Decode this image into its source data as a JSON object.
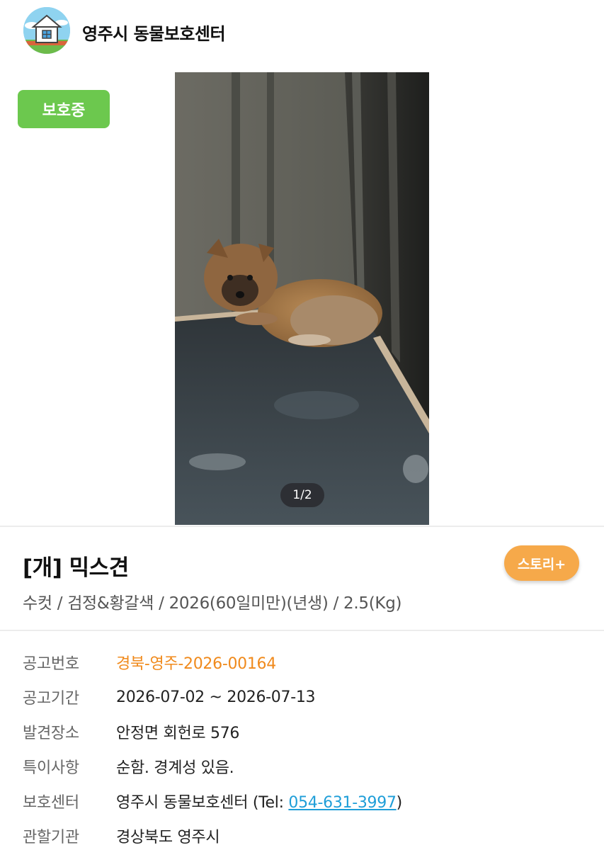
{
  "header": {
    "logo_icon": "shelter-house-icon",
    "shelter_name": "영주시 동물보호센터"
  },
  "status": {
    "label": "보호중",
    "color": "#6cc84e"
  },
  "photo": {
    "counter": "1/2",
    "subject": "puppy-photo"
  },
  "animal": {
    "title": "[개] 믹스견",
    "subtitle": "수컷 / 검정&황갈색 / 2026(60일미만)(년생) / 2.5(Kg)",
    "story_label": "스토리+",
    "story_color": "#f6a94a"
  },
  "info": {
    "notice_no_label": "공고번호",
    "notice_no": "경북-영주-2026-00164",
    "period_label": "공고기간",
    "period": "2026-07-02 ~ 2026-07-13",
    "place_label": "발견장소",
    "place": "안정면 회헌로 576",
    "notes_label": "특이사항",
    "notes": "순함. 경계성 있음.",
    "center_label": "보호센터",
    "center_prefix": "영주시 동물보호센터 (Tel: ",
    "center_phone": "054-631-3997",
    "center_suffix": ")",
    "authority_label": "관할기관",
    "authority": "경상북도 영주시"
  }
}
